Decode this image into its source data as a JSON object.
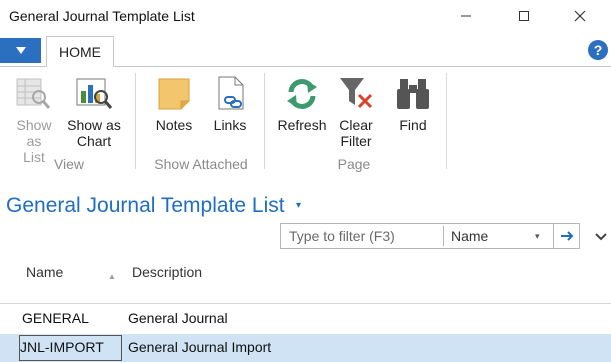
{
  "window": {
    "title": "General Journal Template List",
    "minimize_glyph": "—",
    "close_glyph": "✕"
  },
  "ribbon": {
    "app_menu_glyph": "▼",
    "tabs": [
      {
        "label": "HOME",
        "active": true
      }
    ],
    "help_glyph": "?",
    "groups": [
      {
        "label": "View",
        "buttons": [
          {
            "label_line1": "Show",
            "label_line2": "as List",
            "icon": "list-view-icon",
            "enabled": false
          },
          {
            "label_line1": "Show as",
            "label_line2": "Chart",
            "icon": "chart-view-icon",
            "enabled": true
          }
        ]
      },
      {
        "label": "Show Attached",
        "buttons": [
          {
            "label_line1": "Notes",
            "label_line2": "",
            "icon": "note-icon",
            "enabled": true
          },
          {
            "label_line1": "Links",
            "label_line2": "",
            "icon": "link-icon",
            "enabled": true
          }
        ]
      },
      {
        "label": "Page",
        "buttons": [
          {
            "label_line1": "Refresh",
            "label_line2": "",
            "icon": "refresh-icon",
            "enabled": true
          },
          {
            "label_line1": "Clear",
            "label_line2": "Filter",
            "icon": "clear-filter-icon",
            "enabled": true
          },
          {
            "label_line1": "Find",
            "label_line2": "",
            "icon": "binoculars-icon",
            "enabled": true
          }
        ]
      }
    ]
  },
  "page": {
    "title": "General Journal Template List",
    "title_caret": "▾"
  },
  "filter": {
    "placeholder": "Type to filter (F3)",
    "field": "Name",
    "field_caret": "▾"
  },
  "table": {
    "columns": [
      "Name",
      "Description"
    ],
    "sort_indicator": "▲",
    "rows": [
      {
        "name": "GENERAL",
        "description": "General Journal",
        "selected": false
      },
      {
        "name": "JNL-IMPORT",
        "description": "General Journal Import",
        "selected": true
      }
    ]
  },
  "colors": {
    "accent": "#1f6ec2",
    "app_menu": "#2a6fc0",
    "selected_row": "#cfe3f5",
    "disabled_text": "#9a9a9a"
  }
}
